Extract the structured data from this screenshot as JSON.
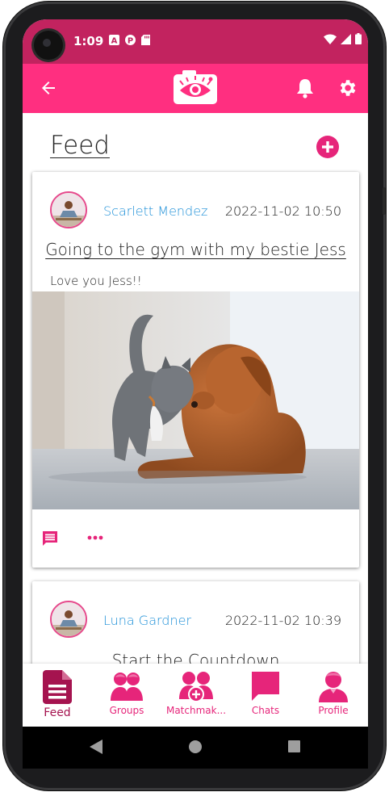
{
  "status_bar": {
    "time": "1:09",
    "left_icons": [
      "app-a-icon",
      "app-p-icon",
      "sd-card-icon"
    ],
    "right_icons": [
      "wifi-icon",
      "signal-icon",
      "battery-icon"
    ]
  },
  "app_bar": {
    "back_icon": "arrow-left-icon",
    "logo_icon": "camera-eye-logo",
    "bell_icon": "bell-icon",
    "settings_icon": "gear-icon"
  },
  "feed": {
    "title": "Feed",
    "add_icon": "plus-circle-icon",
    "posts": [
      {
        "author": "Scarlett Mendez",
        "date": "2022-11-02 10:50",
        "title": "Going to the gym with my bestie Jess",
        "body": "Love you Jess!!",
        "image": "cat-and-dog-photo"
      },
      {
        "author": "Luna Gardner",
        "date": "2022-11-02 10:39",
        "title": "Start the Countdown"
      }
    ]
  },
  "bottom_nav": {
    "items": [
      {
        "label": "Feed",
        "icon": "document-icon",
        "active": true
      },
      {
        "label": "Groups",
        "icon": "group-icon",
        "active": false
      },
      {
        "label": "Matchmak...",
        "icon": "matchmaking-icon",
        "active": false
      },
      {
        "label": "Chats",
        "icon": "chat-bubble-icon",
        "active": false
      },
      {
        "label": "Profile",
        "icon": "profile-icon",
        "active": false
      }
    ]
  },
  "colors": {
    "status_bar": "#c2235f",
    "app_bar": "#ff2f80",
    "accent": "#e6257a",
    "active_nav": "#a5134f",
    "author_link": "#1e90d8"
  }
}
